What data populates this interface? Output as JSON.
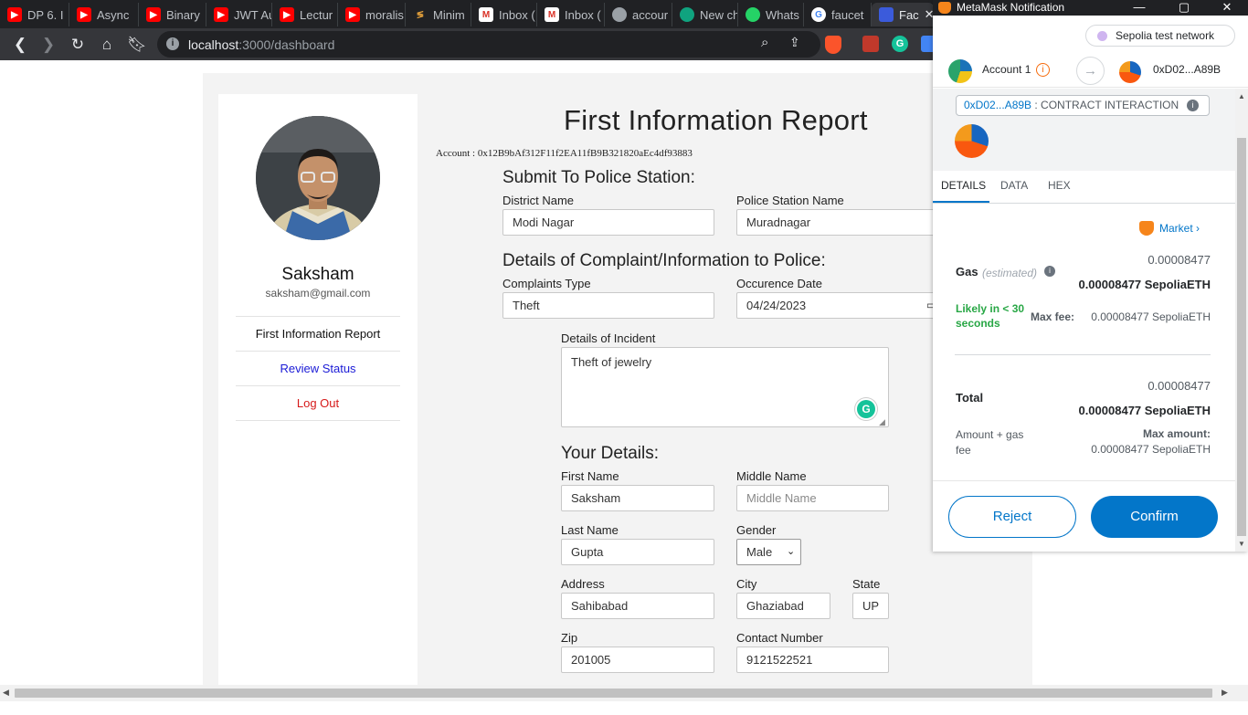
{
  "browser": {
    "tabs": [
      {
        "label": "DP 6. I",
        "icon": "youtube-icon"
      },
      {
        "label": "Async",
        "icon": "youtube-icon"
      },
      {
        "label": "Binary",
        "icon": "youtube-icon"
      },
      {
        "label": "JWT Au",
        "icon": "youtube-icon"
      },
      {
        "label": "Lectur",
        "icon": "youtube-icon"
      },
      {
        "label": "moralis",
        "icon": "youtube-icon"
      },
      {
        "label": "Minim",
        "icon": "minim-icon"
      },
      {
        "label": "Inbox (",
        "icon": "gmail-icon"
      },
      {
        "label": "Inbox (",
        "icon": "gmail-icon"
      },
      {
        "label": "accour",
        "icon": "globe-icon"
      },
      {
        "label": "New ch",
        "icon": "chatgpt-icon"
      },
      {
        "label": "Whats",
        "icon": "whatsapp-icon"
      },
      {
        "label": "faucet",
        "icon": "google-icon"
      },
      {
        "label": "Fac",
        "icon": "faucet-icon"
      }
    ],
    "url_host": "localhost",
    "url_path": ":3000/dashboard"
  },
  "sidebar": {
    "name": "Saksham",
    "email": "saksham@gmail.com",
    "nav": [
      {
        "label": "First Information Report",
        "color": "#111111"
      },
      {
        "label": "Review Status",
        "color": "#1a1ad6"
      },
      {
        "label": "Log Out",
        "color": "#d61a1a"
      }
    ]
  },
  "form": {
    "title": "First Information Report",
    "account": "Account : 0x12B9bAf312F11f2EA11fB9B321820aEc4df93883",
    "section_police": "Submit To Police Station:",
    "district_label": "District Name",
    "district_value": "Modi Nagar",
    "station_label": "Police Station Name",
    "station_value": "Muradnagar",
    "section_complaint": "Details of Complaint/Information to Police:",
    "complaint_type_label": "Complaints Type",
    "complaint_type_value": "Theft",
    "occurrence_label": "Occurence Date",
    "occurrence_value": "04/24/2023",
    "incident_label": "Details of Incident",
    "incident_value": "Theft of jewelry",
    "section_your": "Your Details:",
    "first_name_label": "First Name",
    "first_name_value": "Saksham",
    "middle_name_label": "Middle Name",
    "middle_name_placeholder": "Middle Name",
    "last_name_label": "Last Name",
    "last_name_value": "Gupta",
    "gender_label": "Gender",
    "gender_value": "Male",
    "address_label": "Address",
    "address_value": "Sahibabad",
    "city_label": "City",
    "city_value": "Ghaziabad",
    "state_label": "State",
    "state_value": "UP",
    "zip_label": "Zip",
    "zip_value": "201005",
    "contact_label": "Contact Number",
    "contact_value": "9121522521"
  },
  "metamask": {
    "window_title": "MetaMask Notification",
    "network": "Sepolia test network",
    "from_account": "Account 1",
    "to_address": "0xD02...A89B",
    "contract_address": "0xD02...A89B",
    "contract_label": ": CONTRACT INTERACTION",
    "tabs": [
      "DETAILS",
      "DATA",
      "HEX"
    ],
    "market_label": "Market",
    "gas_label": "Gas",
    "gas_estimated": "(estimated)",
    "gas_small": "0.00008477",
    "gas_bold": "0.00008477 SepoliaETH",
    "likely_label": "Likely in < 30 seconds",
    "max_fee_label": "Max fee:",
    "max_fee_value": "0.00008477 SepoliaETH",
    "total_label": "Total",
    "total_small": "0.00008477",
    "total_bold": "0.00008477 SepoliaETH",
    "amount_gas_label": "Amount + gas fee",
    "max_amount_label": "Max amount:",
    "max_amount_value": "0.00008477 SepoliaETH",
    "reject_label": "Reject",
    "confirm_label": "Confirm",
    "accent": "#0376c9",
    "success": "#28a745"
  }
}
